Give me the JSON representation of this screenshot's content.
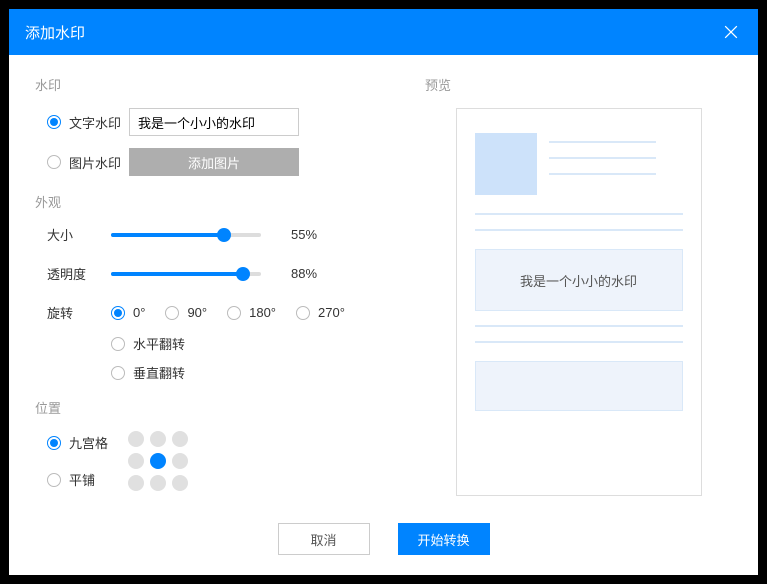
{
  "header": {
    "title": "添加水印"
  },
  "watermark": {
    "section_title": "水印",
    "text_option_label": "文字水印",
    "text_value": "我是一个小小的水印",
    "image_option_label": "图片水印",
    "add_image_label": "添加图片",
    "selected": "text"
  },
  "appearance": {
    "section_title": "外观",
    "size_label": "大小",
    "size_value": "55%",
    "size_percent": 55,
    "opacity_label": "透明度",
    "opacity_value": "88%",
    "opacity_percent": 88,
    "rotate_label": "旋转",
    "rotate_options": [
      "0°",
      "90°",
      "180°",
      "270°"
    ],
    "rotate_selected": 0,
    "flip_h_label": "水平翻转",
    "flip_v_label": "垂直翻转"
  },
  "position": {
    "section_title": "位置",
    "grid_label": "九宫格",
    "tile_label": "平铺",
    "selected": "grid",
    "grid_active_index": 4
  },
  "preview": {
    "title": "预览",
    "watermark_text": "我是一个小小的水印"
  },
  "footer": {
    "cancel": "取消",
    "confirm": "开始转换"
  }
}
